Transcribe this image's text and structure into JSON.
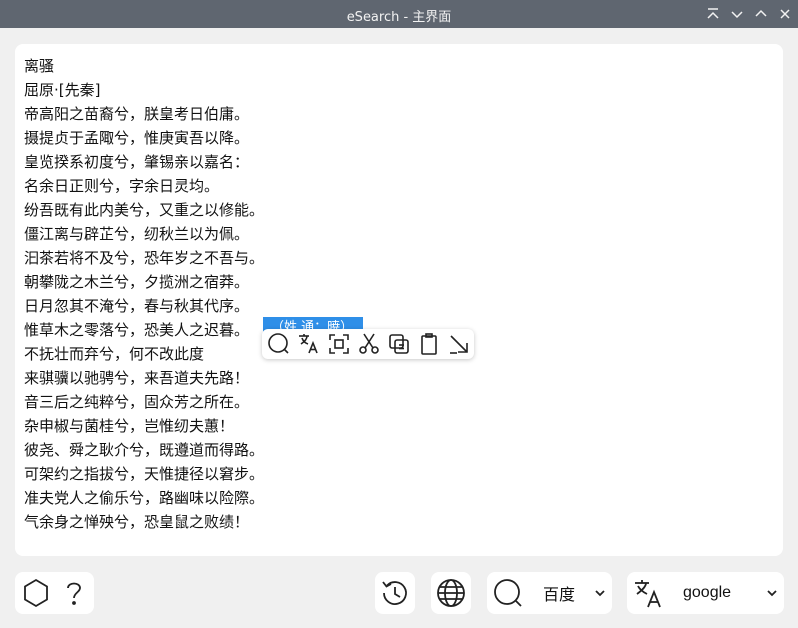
{
  "window": {
    "title": "eSearch - 主界面"
  },
  "editor": {
    "lines": [
      "离骚",
      "屈原·[先秦]",
      "帝高阳之苗裔兮，朕皇考日伯庸。",
      "摄提贞于孟陬兮，惟庚寅吾以降。",
      "皇览揆系初度兮，肇锡亲以嘉名：",
      "名余日正则兮，字余日灵均。",
      "纷吾既有此内美兮，又重之以修能。",
      "僵江离与辟芷兮，纫秋兰以为佩。",
      "汩茶若将不及兮，恐年岁之不吾与。",
      "朝攀陇之木兰兮，夕揽洲之宿莽。",
      "日月忽其不淹兮，春与秋其代序。",
      "惟草木之零落兮，恐美人之迟暮。",
      "不抚壮而弃兮，何不改此度",
      "来骐骥以驰骋兮，来吾道夫先路！",
      "音三后之纯粹兮，固众芳之所在。",
      "杂申椒与菌桂兮，岂惟纫夫蕙！",
      "彼尧、舜之耿介兮，既遵道而得路。",
      "可架约之指拔兮，天惟捷径以窘步。",
      "准夫党人之偷乐兮，路幽味以险際。",
      "气余身之惮殃兮，恐皇鼠之败绩！"
    ],
    "selection_text": "（姓 通：暁）"
  },
  "context_toolbar": {
    "icons": [
      "search-icon",
      "translate-icon",
      "ocr-scan-icon",
      "cut-icon",
      "copy-icon",
      "paste-icon",
      "delete-icon"
    ]
  },
  "bottom": {
    "search_engine": "百度",
    "translate_engine": "google"
  },
  "colors": {
    "titlebar": "#5f6670",
    "selection": "#2f8fe8",
    "background": "#f0f0f0"
  }
}
